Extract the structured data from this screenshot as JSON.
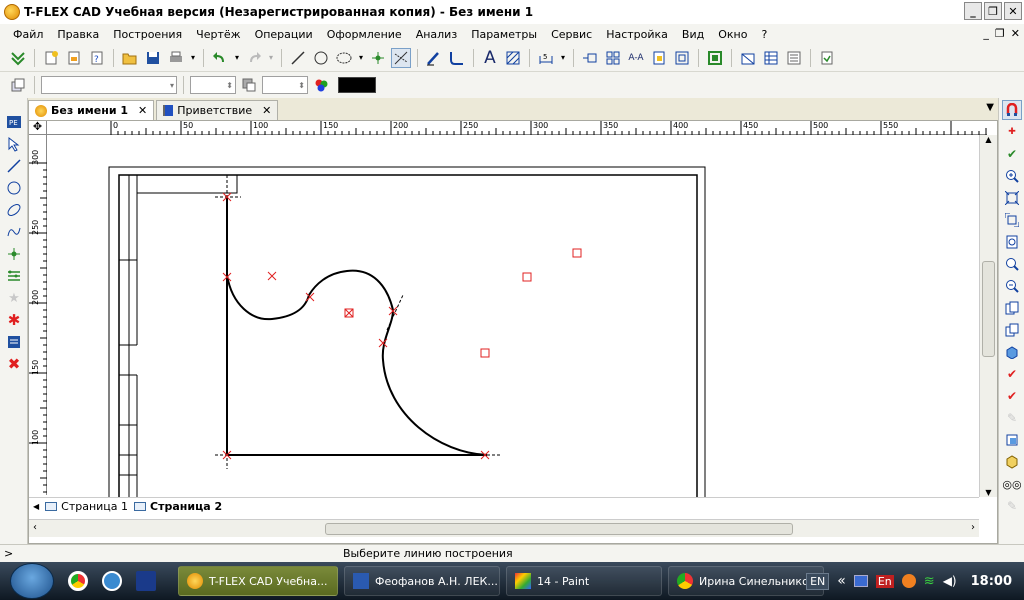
{
  "window": {
    "title": "T-FLEX CAD Учебная версия (Незарегистрированная копия) - Без имени 1",
    "btn_minimize": "_",
    "btn_restore": "❐",
    "btn_close": "✕"
  },
  "menu": {
    "items": [
      "Файл",
      "Правка",
      "Построения",
      "Чертёж",
      "Операции",
      "Оформление",
      "Анализ",
      "Параметры",
      "Сервис",
      "Настройка",
      "Вид",
      "Окно",
      "?"
    ],
    "mdi": {
      "minimize": "_",
      "restore": "❐",
      "close": "✕"
    }
  },
  "toolbar1": {
    "icons": [
      "insert-icon",
      "new-icon",
      "new-template-icon",
      "new-assembly-icon",
      "open-icon",
      "save-icon",
      "print-icon",
      "undo-icon",
      "redo-icon",
      "line-icon",
      "circle-icon",
      "ellipse-icon",
      "node-icon",
      "build-line-icon",
      "draw-icon",
      "fillet-icon",
      "text-icon",
      "hatch-icon",
      "dimension-icon",
      "view-icon",
      "layer-icon",
      "align-icon",
      "grid-icon",
      "table-icon",
      "fragment-icon",
      "zoom-window-icon",
      "insert-image-icon",
      "variables-icon",
      "export-icon"
    ]
  },
  "toolbar2": {
    "color": "#000000"
  },
  "tabs": [
    {
      "label": "Без имени 1",
      "close": "✕",
      "active": true
    },
    {
      "label": "Приветствие",
      "close": "✕",
      "active": false
    }
  ],
  "tab_menu": "▼",
  "ruler": {
    "h_labels": [
      "0",
      "50",
      "100",
      "150",
      "200",
      "250",
      "300",
      "350",
      "400",
      "450",
      "500",
      "550"
    ],
    "v_labels": [
      "300",
      "250",
      "200",
      "150",
      "100"
    ]
  },
  "pages": [
    {
      "label": "Страница 1",
      "active": false
    },
    {
      "label": "Страница 2",
      "active": true
    }
  ],
  "status": {
    "prompt": ">",
    "message": "Выберите линию построения"
  },
  "taskbar": {
    "tasks": [
      {
        "label": "T-FLEX CAD Учебна...",
        "icon": "tflex-icon",
        "active": true
      },
      {
        "label": "Феофанов А.Н. ЛЕК...",
        "icon": "word-icon",
        "active": false
      },
      {
        "label": "14 - Paint",
        "icon": "paint-icon",
        "active": false
      },
      {
        "label": "Ирина Синельнико...",
        "icon": "chrome-icon",
        "active": false
      }
    ],
    "lang": "EN",
    "lang2": "En",
    "tray_chevron": "«",
    "clock": "18:00"
  }
}
